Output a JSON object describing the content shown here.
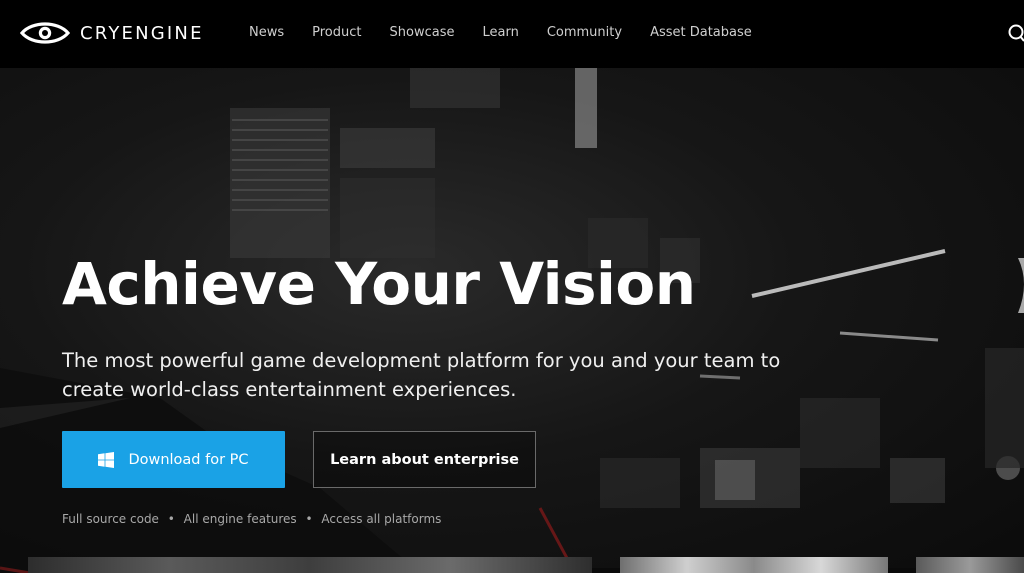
{
  "header": {
    "logo_text": "CRYENGINE",
    "nav": [
      {
        "label": "News"
      },
      {
        "label": "Product"
      },
      {
        "label": "Showcase"
      },
      {
        "label": "Learn"
      },
      {
        "label": "Community"
      },
      {
        "label": "Asset Database"
      }
    ],
    "search_icon": "search-icon"
  },
  "hero": {
    "title": "Achieve Your Vision",
    "subtitle": "The most powerful game development platform for you and your team to create world-class entertainment experiences.",
    "download_button": {
      "label": "Download for PC",
      "icon": "windows-icon"
    },
    "enterprise_button": {
      "label": "Learn about enterprise"
    },
    "features": [
      "Full source code",
      "All engine features",
      "Access all platforms"
    ],
    "feature_separator": "•"
  },
  "colors": {
    "accent": "#1aa2e6",
    "header_bg": "#000000",
    "text": "#ffffff"
  }
}
